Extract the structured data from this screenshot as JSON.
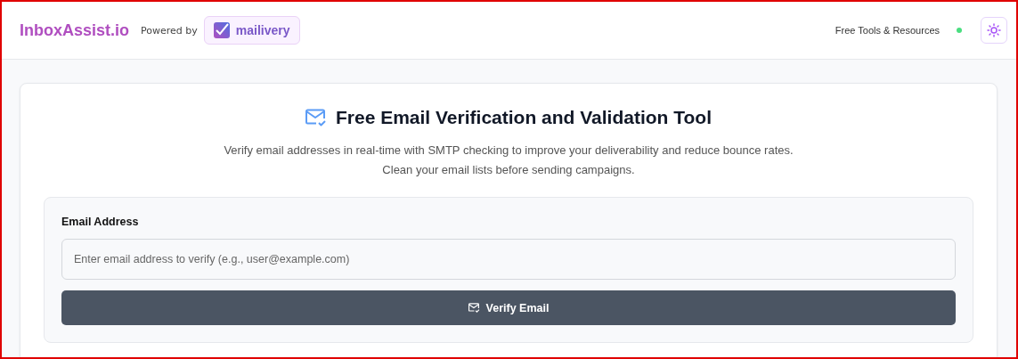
{
  "header": {
    "brand": "InboxAssist.io",
    "powered_by": "Powered by",
    "partner": "mailivery",
    "nav_link": "Free Tools & Resources"
  },
  "tool": {
    "title": "Free Email Verification and Validation Tool",
    "description": "Verify email addresses in real-time with SMTP checking to improve your deliverability and reduce bounce rates. Clean your email lists before sending campaigns.",
    "field_label": "Email Address",
    "placeholder": "Enter email address to verify (e.g., user@example.com)",
    "button": "Verify Email"
  }
}
